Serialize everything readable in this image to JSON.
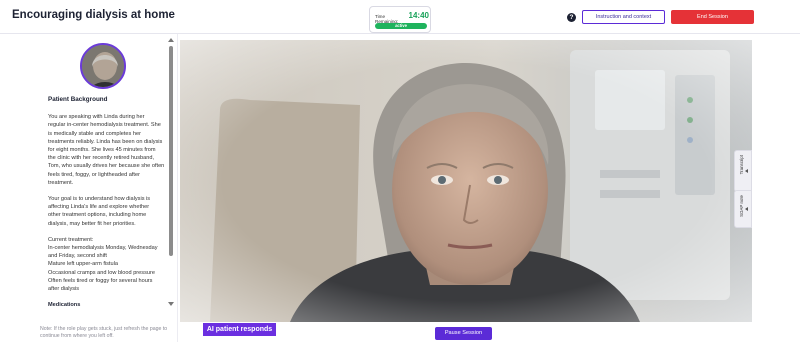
{
  "header": {
    "title": "Encouraging dialysis at home",
    "timer_label": "Time Remaining:",
    "timer_value": "14:40",
    "timer_status": "active",
    "help_icon": "help-circle-icon",
    "instructions_label": "Instruction and context",
    "end_label": "End Session"
  },
  "patient_panel": {
    "avatar_icon": "patient-avatar",
    "background_title": "Patient Background",
    "paragraphs": [
      [
        "You are speaking with Linda during her",
        "regular in-center hemodialysis treatment. She",
        "is medically stable and completes her",
        "treatments reliably. Linda has been on dialysis",
        "for eight months. She lives 45 minutes from",
        "the clinic with her recently retired husband,",
        "Tom, who usually drives her because she often",
        "feels tired, foggy, or lightheaded after",
        "treatment."
      ],
      [
        "Your goal is to understand how dialysis is",
        "affecting Linda's life and explore whether",
        "other treatment options, including home",
        "dialysis, may better fit her priorities."
      ],
      [
        "Current treatment:",
        "In-center hemodialysis Monday, Wednesday",
        "and Friday, second shift",
        "Mature left upper-arm fistula",
        "Occasional cramps and low blood pressure",
        "Often feels tired or foggy for several hours",
        "after dialysis"
      ]
    ],
    "cutoff_line": "Medications",
    "hint": "Note: If the role play gets stuck, just refresh the page to continue from where you left off."
  },
  "video": {
    "caption": "AI patient responds",
    "pause_label": "Pause Session"
  },
  "side_tabs": {
    "transcript": "Transcript",
    "soap": "SOAP note"
  },
  "colors": {
    "accent": "#5b2bd7",
    "danger": "#e53237",
    "success": "#1fb35d"
  }
}
